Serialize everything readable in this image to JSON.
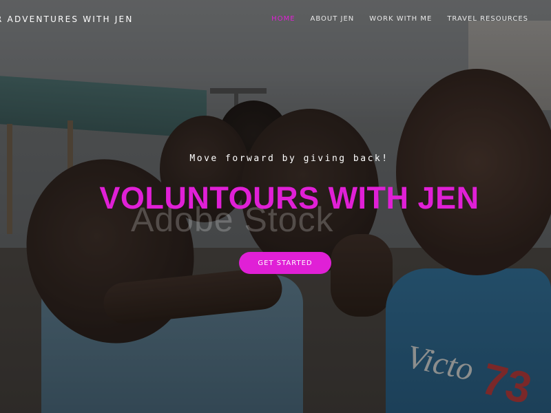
{
  "header": {
    "brand": "R ADVENTURES WITH JEN",
    "nav": [
      {
        "label": "HOME",
        "active": true
      },
      {
        "label": "ABOUT JEN",
        "active": false
      },
      {
        "label": "WORK WITH ME",
        "active": false
      },
      {
        "label": "TRAVEL RESOURCES",
        "active": false
      }
    ]
  },
  "hero": {
    "tagline": "Move forward by giving back!",
    "headline": "VOLUNTOURS WITH JEN",
    "cta_label": "GET STARTED",
    "watermark": "Adobe Stock",
    "shirt_text": "Victo",
    "shirt_number": "73"
  },
  "colors": {
    "accent": "#e020d6",
    "nav_text": "#e9e9e9",
    "text": "#ffffff"
  }
}
